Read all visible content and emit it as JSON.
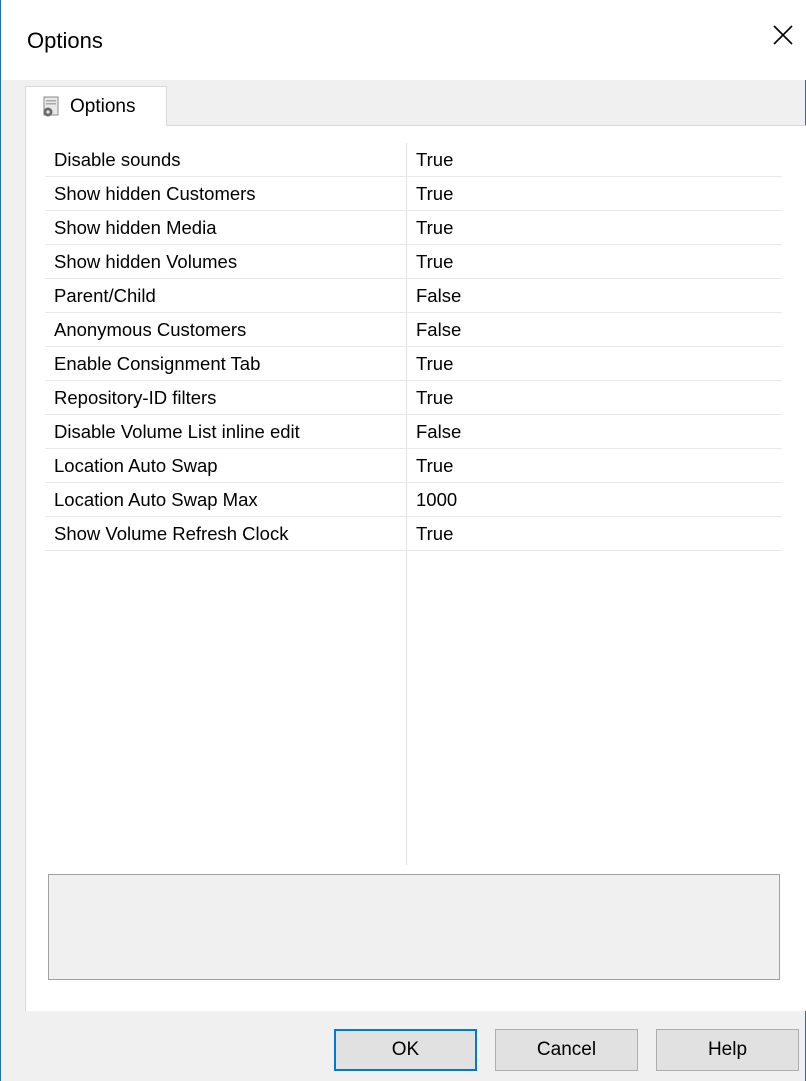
{
  "window": {
    "title": "Options"
  },
  "tabs": [
    {
      "label": "Options",
      "icon": "options-tab-icon"
    }
  ],
  "properties": [
    {
      "name": "Disable sounds",
      "value": "True"
    },
    {
      "name": "Show hidden Customers",
      "value": "True"
    },
    {
      "name": "Show hidden Media",
      "value": "True"
    },
    {
      "name": "Show hidden Volumes",
      "value": "True"
    },
    {
      "name": "Parent/Child",
      "value": "False"
    },
    {
      "name": "Anonymous Customers",
      "value": "False"
    },
    {
      "name": "Enable Consignment Tab",
      "value": "True"
    },
    {
      "name": "Repository-ID filters",
      "value": "True"
    },
    {
      "name": "Disable Volume List inline edit",
      "value": "False"
    },
    {
      "name": "Location Auto Swap",
      "value": "True"
    },
    {
      "name": "Location Auto Swap Max",
      "value": "1000"
    },
    {
      "name": "Show Volume Refresh Clock",
      "value": "True"
    }
  ],
  "description": "",
  "buttons": {
    "ok": "OK",
    "cancel": "Cancel",
    "help": "Help"
  },
  "colors": {
    "window_border": "#1f6fb8",
    "default_button_border": "#0078d7"
  }
}
